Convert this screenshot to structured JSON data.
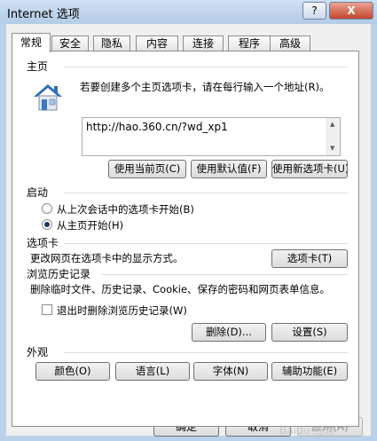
{
  "window": {
    "title": "Internet 选项",
    "help_label": "?",
    "close_label": "X"
  },
  "tabs": [
    {
      "label": "常规",
      "active": true
    },
    {
      "label": "安全"
    },
    {
      "label": "隐私"
    },
    {
      "label": "内容"
    },
    {
      "label": "连接"
    },
    {
      "label": "程序"
    },
    {
      "label": "高级"
    }
  ],
  "home": {
    "heading": "主页",
    "description": "若要创建多个主页选项卡，请在每行输入一个地址(R)。",
    "url": "http://hao.360.cn/?wd_xp1",
    "btn_current": "使用当前页(C)",
    "btn_default": "使用默认值(F)",
    "btn_blank": "使用新选项卡(U)"
  },
  "startup": {
    "heading": "启动",
    "option_last": "从上次会话中的选项卡开始(B)",
    "option_home": "从主页开始(H)",
    "selected": "option_home"
  },
  "tabs_section": {
    "heading": "选项卡",
    "description": "更改网页在选项卡中的显示方式。",
    "btn": "选项卡(T)"
  },
  "history": {
    "heading": "浏览历史记录",
    "description": "删除临时文件、历史记录、Cookie、保存的密码和网页表单信息。",
    "checkbox_label": "退出时删除浏览历史记录(W)",
    "checkbox_checked": false,
    "btn_delete": "删除(D)...",
    "btn_settings": "设置(S)"
  },
  "appearance": {
    "heading": "外观",
    "btn_colors": "颜色(O)",
    "btn_languages": "语言(L)",
    "btn_fonts": "字体(N)",
    "btn_accessibility": "辅助功能(E)"
  },
  "footer": {
    "ok": "确定",
    "cancel": "取消",
    "apply": "应用(A)"
  },
  "watermark": "Baidu 经验",
  "colors": {
    "titlebar": "#b9d1ea",
    "close_button": "#c4442b",
    "panel_bg": "#ffffff",
    "dialog_bg": "#f0f0f0"
  }
}
